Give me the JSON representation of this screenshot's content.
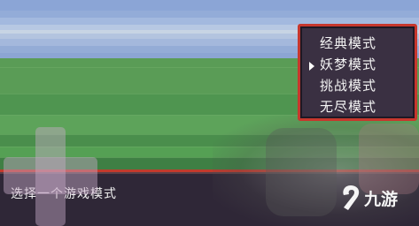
{
  "menu": {
    "items": [
      {
        "label": "经典模式",
        "selected": false
      },
      {
        "label": "妖梦模式",
        "selected": true
      },
      {
        "label": "挑战模式",
        "selected": false
      },
      {
        "label": "无尽模式",
        "selected": false
      }
    ]
  },
  "message": {
    "text": "选择一个游戏模式"
  },
  "watermark": {
    "text": "九游"
  },
  "colors": {
    "menu_border": "#c7372d",
    "menu_bg": "#3a3042",
    "msgbox_border": "#c23a2c"
  }
}
